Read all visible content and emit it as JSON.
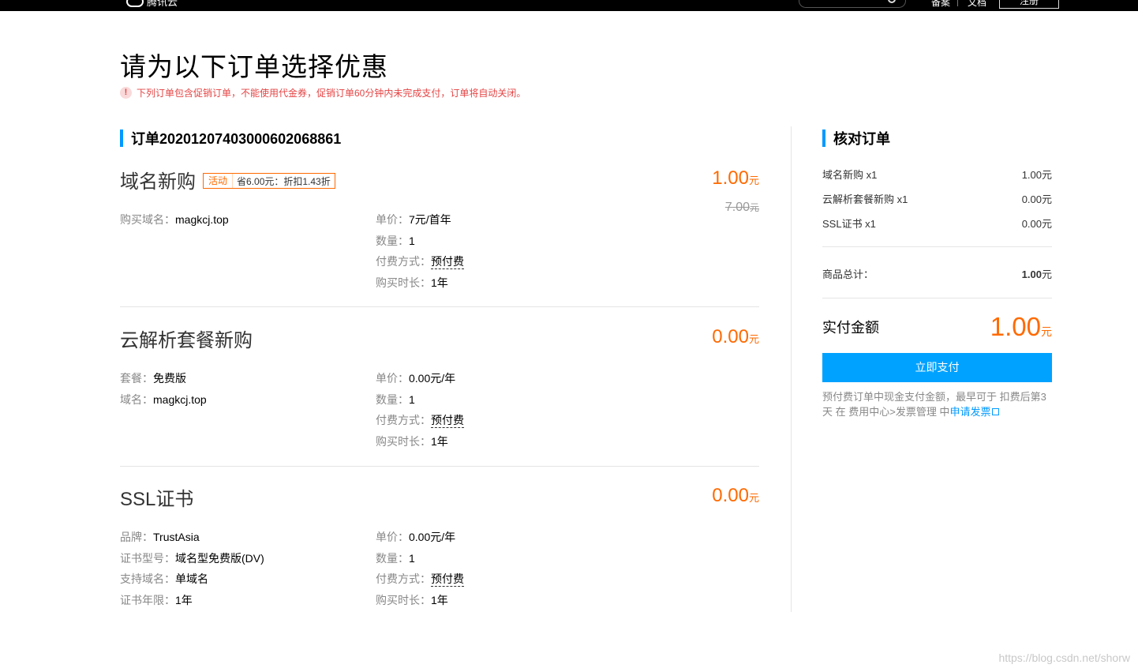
{
  "topbar": {
    "logo_text": "腾讯云",
    "link1": "备案",
    "link2": "文档",
    "register_label": "注册"
  },
  "page": {
    "title": "请为以下订单选择优惠",
    "notice": "下列订单包含促销订单，不能使用代金券，促销订单60分钟内未完成支付，订单将自动关闭。",
    "notice_icon": "!"
  },
  "order": {
    "heading": "订单20201207403000602068861",
    "items": [
      {
        "name": "域名新购",
        "promo_tag": "活动",
        "promo_text": "省6.00元：折扣1.43折",
        "price": "1.00",
        "currency": "元",
        "original_price": "7.00",
        "left": [
          {
            "k": "购买域名：",
            "v": "magkcj.top"
          }
        ],
        "right": [
          {
            "k": "单价：",
            "v": "7元/首年"
          },
          {
            "k": "数量：",
            "v": "1"
          },
          {
            "k": "付费方式：",
            "v": "预付费"
          },
          {
            "k": "购买时长：",
            "v": "1年"
          }
        ]
      },
      {
        "name": "云解析套餐新购",
        "price": "0.00",
        "currency": "元",
        "left": [
          {
            "k": "套餐：",
            "v": "免费版"
          },
          {
            "k": "域名：",
            "v": "magkcj.top"
          }
        ],
        "right": [
          {
            "k": "单价：",
            "v": "0.00元/年"
          },
          {
            "k": "数量：",
            "v": "1"
          },
          {
            "k": "付费方式：",
            "v": "预付费"
          },
          {
            "k": "购买时长：",
            "v": "1年"
          }
        ]
      },
      {
        "name": "SSL证书",
        "price": "0.00",
        "currency": "元",
        "left": [
          {
            "k": "品牌：",
            "v": "TrustAsia"
          },
          {
            "k": "证书型号：",
            "v": "域名型免费版(DV)"
          },
          {
            "k": "支持域名：",
            "v": "单域名"
          },
          {
            "k": "证书年限：",
            "v": "1年"
          }
        ],
        "right": [
          {
            "k": "单价：",
            "v": "0.00元/年"
          },
          {
            "k": "数量：",
            "v": "1"
          },
          {
            "k": "付费方式：",
            "v": "预付费"
          },
          {
            "k": "购买时长：",
            "v": "1年"
          }
        ]
      }
    ]
  },
  "summary": {
    "heading": "核对订单",
    "lines": [
      {
        "name": "域名新购 x1",
        "amount": "1.00元"
      },
      {
        "name": "云解析套餐新购 x1",
        "amount": "0.00元"
      },
      {
        "name": "SSL证书 x1",
        "amount": "0.00元"
      }
    ],
    "subtotal_label": "商品总计：",
    "subtotal_amount": "1.00",
    "subtotal_unit": "元",
    "total_label": "实付金额",
    "total_amount": "1.00",
    "total_unit": "元",
    "pay_button": "立即支付",
    "note_text": "预付费订单中现金支付金额，最早可于 扣费后第3天 在 费用中心>发票管理 中",
    "note_link": "申请发票"
  },
  "watermark": "https://blog.csdn.net/shorw",
  "colors": {
    "accent_blue": "#00a2ff",
    "price_orange": "#ff6a00",
    "notice_red": "#e54545"
  }
}
